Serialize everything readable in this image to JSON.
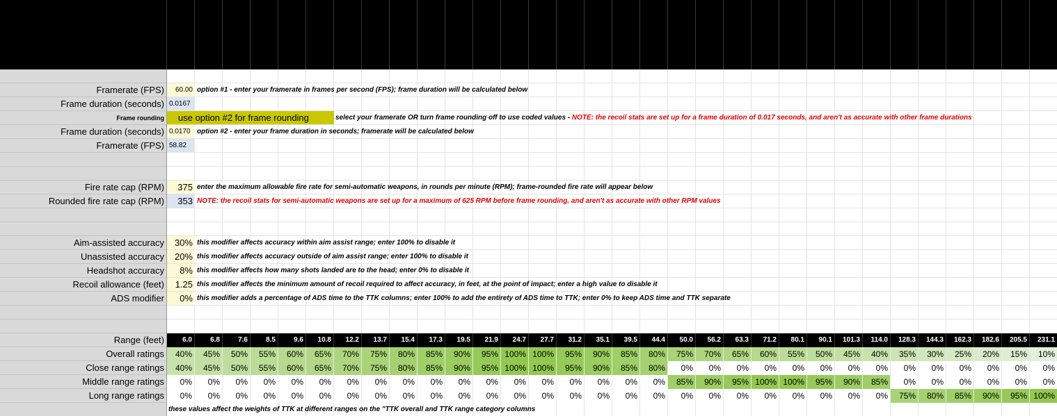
{
  "inputs": {
    "framerate_label": "Framerate (FPS)",
    "framerate_value": "60.00",
    "framerate_note": "option #1 - enter your framerate in frames per second (FPS); frame duration will be calculated below",
    "frame_duration_label": "Frame duration (seconds)",
    "frame_duration_value": "0.0167",
    "frame_rounding_label": "Frame rounding",
    "frame_rounding_value": "use option #2 for frame rounding",
    "frame_rounding_note": "select your framerate OR turn frame rounding off to use coded values - ",
    "frame_rounding_warning": "NOTE: the recoil stats are set up for a frame duration of 0.017 seconds, and aren't as accurate with other frame durations",
    "frame_duration2_label": "Frame duration (seconds)",
    "frame_duration2_value": "0.0170",
    "frame_duration2_note": "option #2 - enter your frame duration in seconds; framerate will be calculated below",
    "framerate2_label": "Framerate (FPS)",
    "framerate2_value": "58.82",
    "fire_rate_cap_label": "Fire rate cap (RPM)",
    "fire_rate_cap_value": "375",
    "fire_rate_cap_note": "enter the maximum allowable fire rate for semi-automatic weapons, in rounds per minute (RPM); frame-rounded fire rate will appear below",
    "rounded_cap_label": "Rounded fire rate cap (RPM)",
    "rounded_cap_value": "353",
    "rounded_cap_note": "NOTE: the recoil stats for semi-automatic weapons are set up for a maximum of 625 RPM before frame rounding, and aren't as accurate with other RPM values",
    "aim_assisted_label": "Aim-assisted accuracy",
    "aim_assisted_value": "30%",
    "aim_assisted_note": "this modifier affects accuracy within aim assist range; enter 100% to disable it",
    "unassisted_label": "Unassisted accuracy",
    "unassisted_value": "20%",
    "unassisted_note": "this modifier affects accuracy outside of aim assist range; enter 100% to disable it",
    "headshot_label": "Headshot accuracy",
    "headshot_value": "8%",
    "headshot_note": "this modifier affects how many shots landed are to the head; enter 0% to disable it",
    "recoil_label": "Recoil allowance (feet)",
    "recoil_value": "1.25",
    "recoil_note": "this modifier affects the minimum amount of recoil required to affect accuracy, in feet, at the point of impact; enter a high value to disable it",
    "ads_label": "ADS modifier",
    "ads_value": "0%",
    "ads_note": "this modifier adds a percentage of ADS time to the TTK columns; enter 100% to add the entirety of ADS time to TTK; enter 0% to keep ADS time and TTK separate"
  },
  "ratings": {
    "range_label": "Range (feet)",
    "ranges": [
      "6.0",
      "6.8",
      "7.6",
      "8.5",
      "9.6",
      "10.8",
      "12.2",
      "13.7",
      "15.4",
      "17.3",
      "19.5",
      "21.9",
      "24.7",
      "27.7",
      "31.2",
      "35.1",
      "39.5",
      "44.4",
      "50.0",
      "56.2",
      "63.3",
      "71.2",
      "80.1",
      "90.1",
      "101.3",
      "114.0",
      "128.3",
      "144.3",
      "162.3",
      "182.6",
      "205.5",
      "231.1"
    ],
    "rows": [
      {
        "label": "Overall ratings",
        "values": [
          "40%",
          "45%",
          "50%",
          "55%",
          "60%",
          "65%",
          "70%",
          "75%",
          "80%",
          "85%",
          "90%",
          "95%",
          "100%",
          "100%",
          "95%",
          "90%",
          "85%",
          "80%",
          "75%",
          "70%",
          "65%",
          "60%",
          "55%",
          "50%",
          "45%",
          "40%",
          "35%",
          "30%",
          "25%",
          "20%",
          "15%",
          "10%"
        ]
      },
      {
        "label": "Close range ratings",
        "values": [
          "40%",
          "45%",
          "50%",
          "55%",
          "60%",
          "65%",
          "70%",
          "75%",
          "80%",
          "85%",
          "90%",
          "95%",
          "100%",
          "100%",
          "95%",
          "90%",
          "85%",
          "80%",
          "0%",
          "0%",
          "0%",
          "0%",
          "0%",
          "0%",
          "0%",
          "0%",
          "0%",
          "0%",
          "0%",
          "0%",
          "0%",
          "0%"
        ]
      },
      {
        "label": "Middle range ratings",
        "values": [
          "0%",
          "0%",
          "0%",
          "0%",
          "0%",
          "0%",
          "0%",
          "0%",
          "0%",
          "0%",
          "0%",
          "0%",
          "0%",
          "0%",
          "0%",
          "0%",
          "0%",
          "0%",
          "85%",
          "90%",
          "95%",
          "100%",
          "100%",
          "95%",
          "90%",
          "85%",
          "0%",
          "0%",
          "0%",
          "0%",
          "0%",
          "0%"
        ]
      },
      {
        "label": "Long range ratings",
        "values": [
          "0%",
          "0%",
          "0%",
          "0%",
          "0%",
          "0%",
          "0%",
          "0%",
          "0%",
          "0%",
          "0%",
          "0%",
          "0%",
          "0%",
          "0%",
          "0%",
          "0%",
          "0%",
          "0%",
          "0%",
          "0%",
          "0%",
          "0%",
          "0%",
          "0%",
          "0%",
          "75%",
          "80%",
          "85%",
          "90%",
          "95%",
          "100%"
        ]
      }
    ],
    "footer_note": "these values affect the weights of TTK at different ranges on the \"TTK overall and TTK range category columns"
  },
  "colors": {
    "input_yellow": "#fff9d6",
    "calc_blue": "#dbe5f1",
    "dropdown": "#c9c800",
    "warning_red": "#e00000"
  }
}
